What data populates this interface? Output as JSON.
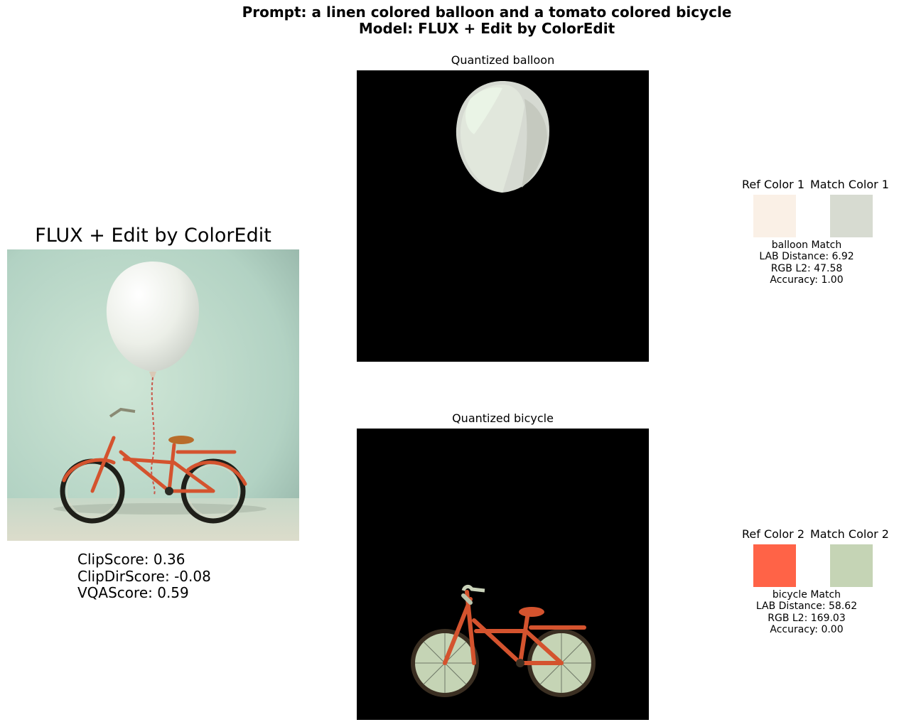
{
  "header": {
    "prompt_line": "Prompt: a linen colored balloon and a tomato colored bicycle",
    "model_line": "Model: FLUX + Edit by ColorEdit"
  },
  "generated": {
    "title": "FLUX + Edit by ColorEdit",
    "scores": {
      "clip": "ClipScore: 0.36",
      "clipdir": "ClipDirScore: -0.08",
      "vqa": "VQAScore: 0.59"
    }
  },
  "quantized": {
    "balloon_title": "Quantized balloon",
    "bicycle_title": "Quantized bicycle"
  },
  "matches": [
    {
      "ref_label": "Ref Color 1",
      "match_label": "Match Color 1",
      "ref_color": "#faf0e6",
      "match_color": "#d7dbd1",
      "name": "balloon Match",
      "lab": "LAB Distance: 6.92",
      "rgb": "RGB L2: 47.58",
      "accuracy": "Accuracy: 1.00"
    },
    {
      "ref_label": "Ref Color 2",
      "match_label": "Match Color 2",
      "ref_color": "#ff6347",
      "match_color": "#c5d4b5",
      "name": "bicycle Match",
      "lab": "LAB Distance: 58.62",
      "rgb": "RGB L2: 169.03",
      "accuracy": "Accuracy: 0.00"
    }
  ]
}
